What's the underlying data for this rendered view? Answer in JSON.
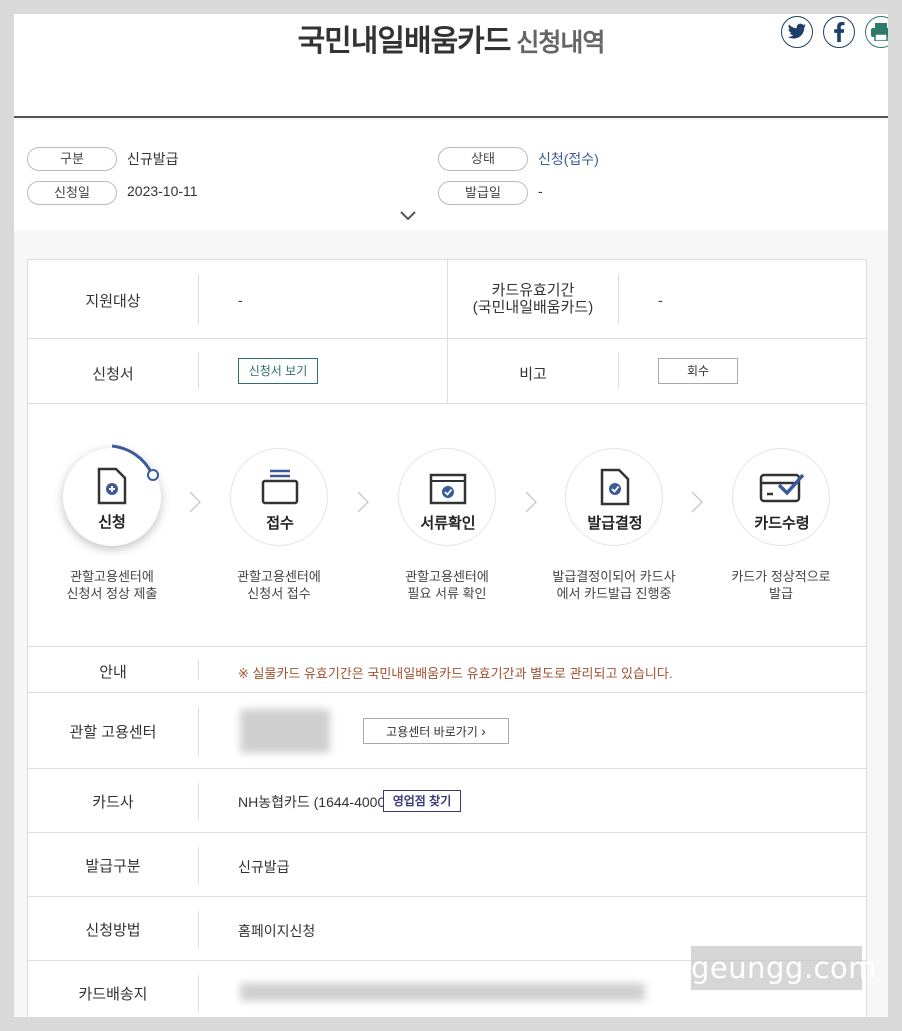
{
  "header": {
    "title": "국민내일배움카드",
    "subtitle": "신청내역",
    "share": [
      "twitter-icon",
      "facebook-icon",
      "print-icon"
    ]
  },
  "summary": {
    "type_label": "구분",
    "type_value": "신규발급",
    "date_label": "신청일",
    "date_value": "2023-10-11",
    "status_label": "상태",
    "status_value": "신청(접수)",
    "issue_label": "발급일",
    "issue_value": "-"
  },
  "detail": {
    "target_label": "지원대상",
    "target_value": "-",
    "validity_label_1": "카드유효기간",
    "validity_label_2": "(국민내일배움카드)",
    "validity_value": "-",
    "form_label": "신청서",
    "form_button": "신청서 보기",
    "note_label": "비고",
    "note_button": "회수"
  },
  "steps": [
    {
      "name": "신청",
      "desc1": "관할고용센터에",
      "desc2": "신청서 정상 제출",
      "icon": "document-plus-icon"
    },
    {
      "name": "접수",
      "desc1": "관할고용센터에",
      "desc2": "신청서 접수",
      "icon": "tray-icon"
    },
    {
      "name": "서류확인",
      "desc1": "관할고용센터에",
      "desc2": "필요 서류 확인",
      "icon": "folder-check-icon"
    },
    {
      "name": "발급결정",
      "desc1": "발급결정이되어 카드사",
      "desc2": "에서 카드발급 진행중",
      "icon": "document-check-icon"
    },
    {
      "name": "카드수령",
      "desc1": "카드가 정상적으로",
      "desc2": "발급",
      "icon": "card-check-icon"
    }
  ],
  "info": {
    "notice_label": "안내",
    "notice_text": "※ 실물카드 유효기간은 국민내일배움카드 유효기간과 별도로 관리되고 있습니다.",
    "center_label": "관할 고용센터",
    "center_button": "고용센터 바로가기",
    "card_label": "카드사",
    "card_value": "NH농협카드 (1644-4000)",
    "card_button": "영업점 찾기",
    "issue_type_label": "발급구분",
    "issue_type_value": "신규발급",
    "method_label": "신청방법",
    "method_value": "홈페이지신청",
    "delivery_label": "카드배송지"
  },
  "watermark": "geungg.com",
  "colors": {
    "accent": "#3a5a9b",
    "notice": "#a0522d",
    "navy": "#1f3f66"
  }
}
